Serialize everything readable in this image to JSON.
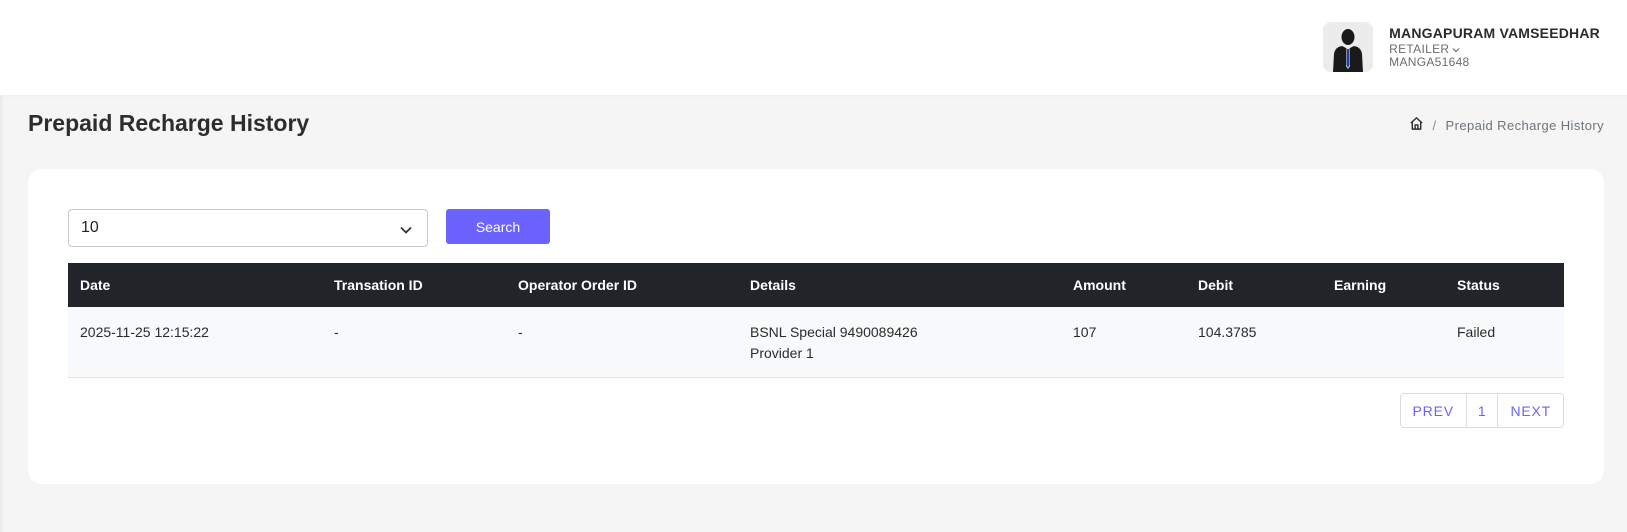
{
  "header": {
    "user_name": "MANGAPURAM VAMSEEDHAR",
    "role": "RETAILER",
    "user_id": "MANGA51648",
    "avatar_icon": "user-silhouette-icon"
  },
  "page": {
    "title": "Prepaid Recharge History",
    "breadcrumb": {
      "home_icon": "home-icon",
      "separator": "/",
      "current": "Prepaid Recharge History"
    }
  },
  "filters": {
    "page_size_selected": "10",
    "search_label": "Search"
  },
  "table": {
    "columns": [
      "Date",
      "Transation ID",
      "Operator Order ID",
      "Details",
      "Amount",
      "Debit",
      "Earning",
      "Status"
    ],
    "rows": [
      {
        "date": "2025-11-25 12:15:22",
        "transaction_id": "-",
        "operator_order_id": "-",
        "details_line1": "BSNL Special 9490089426",
        "details_line2": "Provider 1",
        "amount": "107",
        "debit": "104.3785",
        "earning": "",
        "status": "Failed"
      }
    ]
  },
  "pagination": {
    "prev_label": "PREV",
    "current_page": "1",
    "next_label": "NEXT"
  },
  "colors": {
    "accent": "#6c63ff",
    "table_header_bg": "#212529",
    "page_bg": "#f5f5f5"
  }
}
